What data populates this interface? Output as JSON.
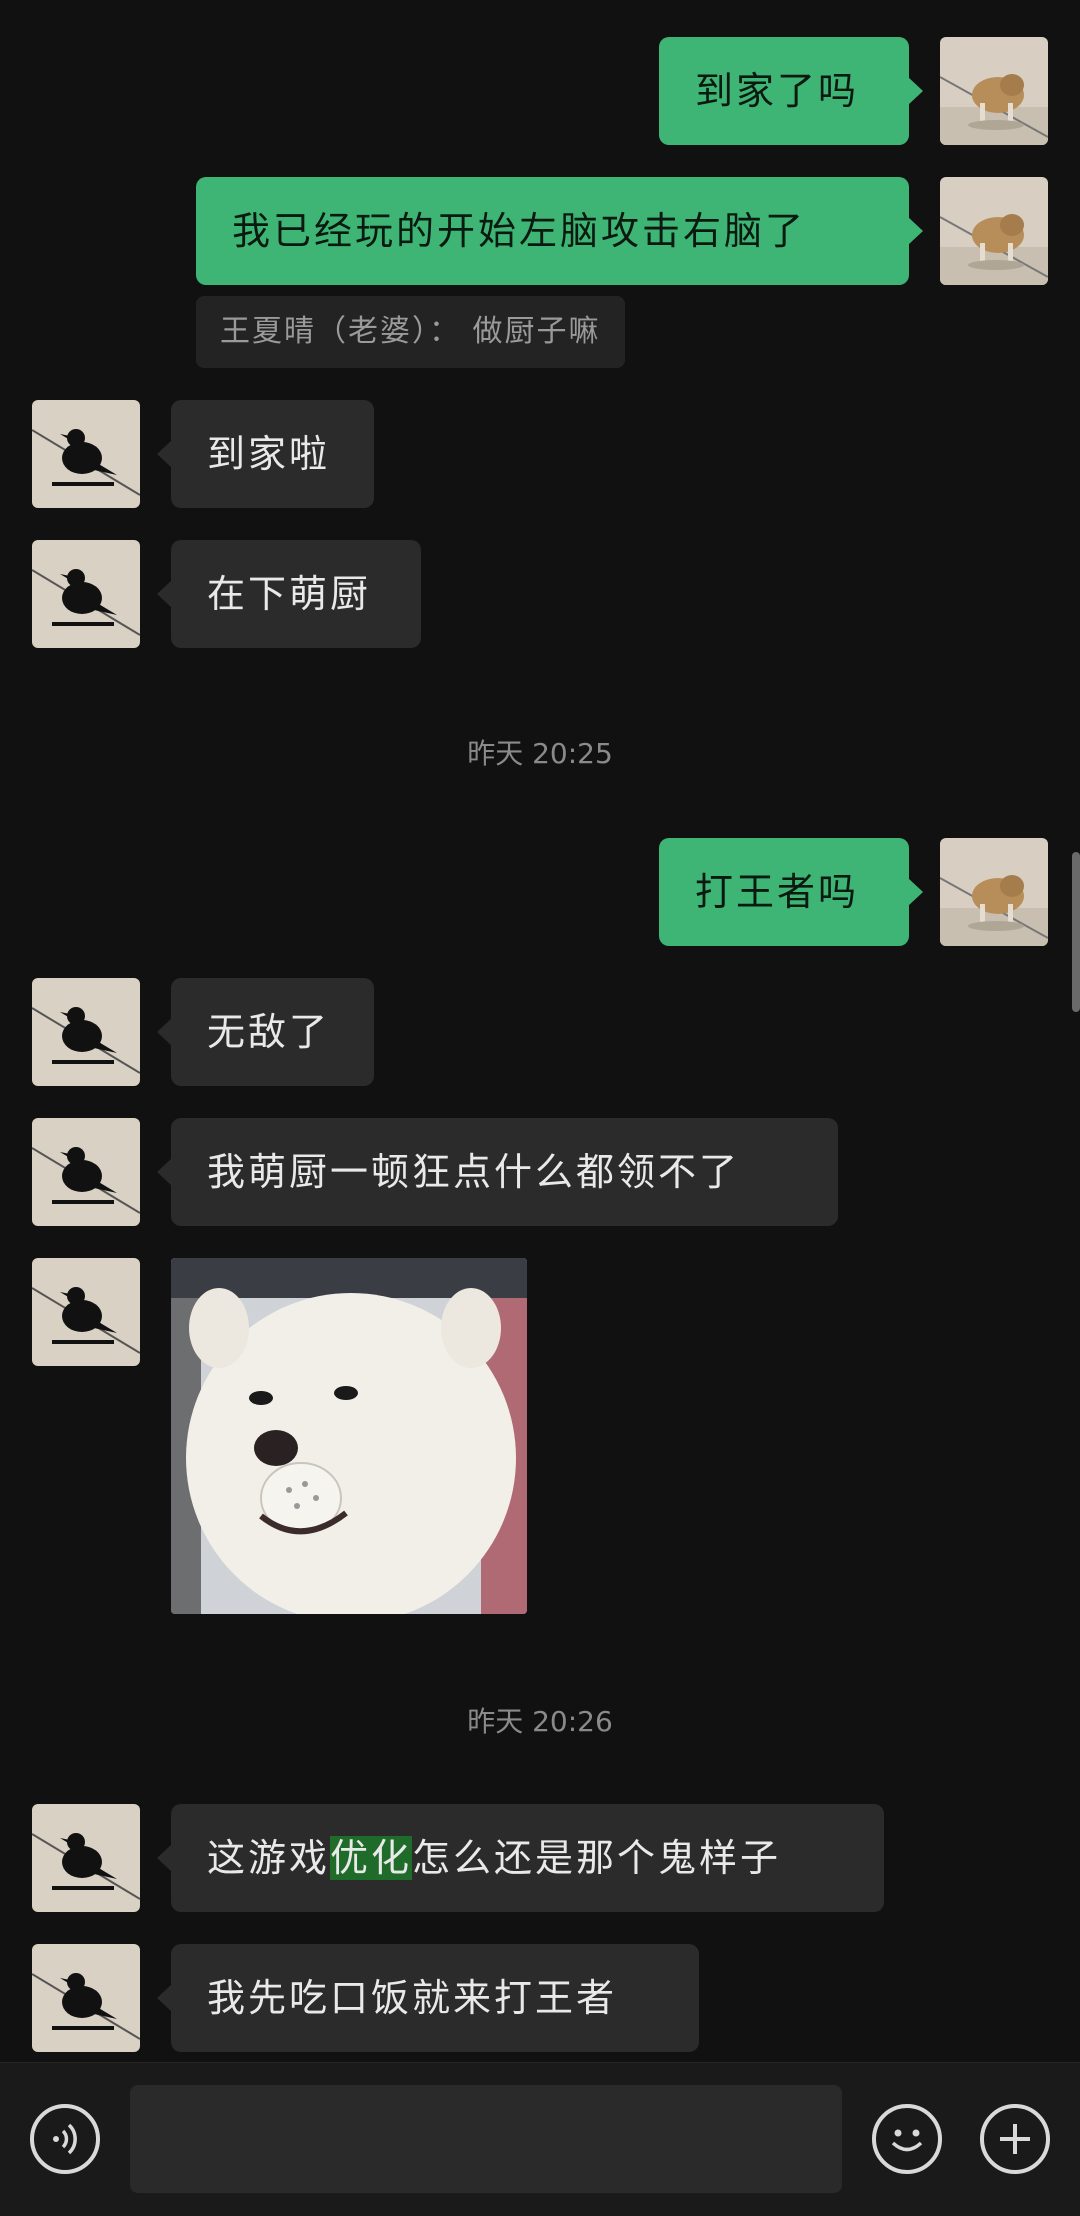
{
  "messages": {
    "m1": "到家了吗",
    "m2": "我已经玩的开始左脑攻击右脑了",
    "m2_quote": "王夏晴（老婆）： 做厨子嘛",
    "m3": "到家啦",
    "m4": "在下萌厨",
    "ts1": "昨天 20:25",
    "m5": "打王者吗",
    "m6": "无敌了",
    "m7": "我萌厨一顿狂点什么都领不了",
    "ts2": "昨天 20:26",
    "m9_before": "这游戏",
    "m9_highlight": "优化",
    "m9_after": "怎么还是那个鬼样子",
    "m10": "我先吃口饭就来打王者"
  },
  "colors": {
    "my_bubble": "#3eb575",
    "their_bubble": "#2b2b2b",
    "background": "#111111",
    "highlight": "#1e6b2a"
  },
  "bottom_bar": {
    "voice_icon": "voice-icon",
    "emoji_icon": "emoji-icon",
    "plus_icon": "plus-icon"
  }
}
